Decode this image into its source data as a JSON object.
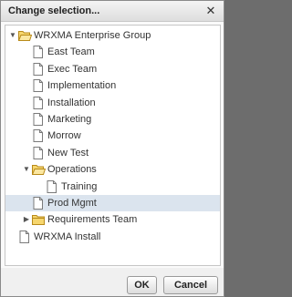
{
  "dialog": {
    "title": "Change selection...",
    "close_glyph": "✕"
  },
  "tree": {
    "rows": [
      {
        "label": "WRXMA Enterprise Group",
        "icon": "folder-open-icon",
        "twisty": "expanded",
        "depth": 0,
        "selected": false
      },
      {
        "label": "East Team",
        "icon": "document-icon",
        "twisty": "none",
        "depth": 1,
        "selected": false
      },
      {
        "label": "Exec Team",
        "icon": "document-icon",
        "twisty": "none",
        "depth": 1,
        "selected": false
      },
      {
        "label": "Implementation",
        "icon": "document-icon",
        "twisty": "none",
        "depth": 1,
        "selected": false
      },
      {
        "label": "Installation",
        "icon": "document-icon",
        "twisty": "none",
        "depth": 1,
        "selected": false
      },
      {
        "label": "Marketing",
        "icon": "document-icon",
        "twisty": "none",
        "depth": 1,
        "selected": false
      },
      {
        "label": "Morrow",
        "icon": "document-icon",
        "twisty": "none",
        "depth": 1,
        "selected": false
      },
      {
        "label": "New Test",
        "icon": "document-icon",
        "twisty": "none",
        "depth": 1,
        "selected": false
      },
      {
        "label": "Operations",
        "icon": "folder-open-icon",
        "twisty": "expanded",
        "depth": 1,
        "selected": false
      },
      {
        "label": "Training",
        "icon": "document-icon",
        "twisty": "none",
        "depth": 2,
        "selected": false
      },
      {
        "label": "Prod Mgmt",
        "icon": "document-icon",
        "twisty": "none",
        "depth": 1,
        "selected": true
      },
      {
        "label": "Requirements Team",
        "icon": "folder-closed-icon",
        "twisty": "collapsed",
        "depth": 1,
        "selected": false
      },
      {
        "label": "WRXMA Install",
        "icon": "document-icon",
        "twisty": "none",
        "depth": 0,
        "selected": false
      }
    ]
  },
  "buttons": {
    "ok_label": "OK",
    "cancel_label": "Cancel"
  },
  "colors": {
    "folder_fill": "#f6d66e",
    "folder_stroke": "#b88a1a",
    "selection": "#dbe4ee"
  }
}
